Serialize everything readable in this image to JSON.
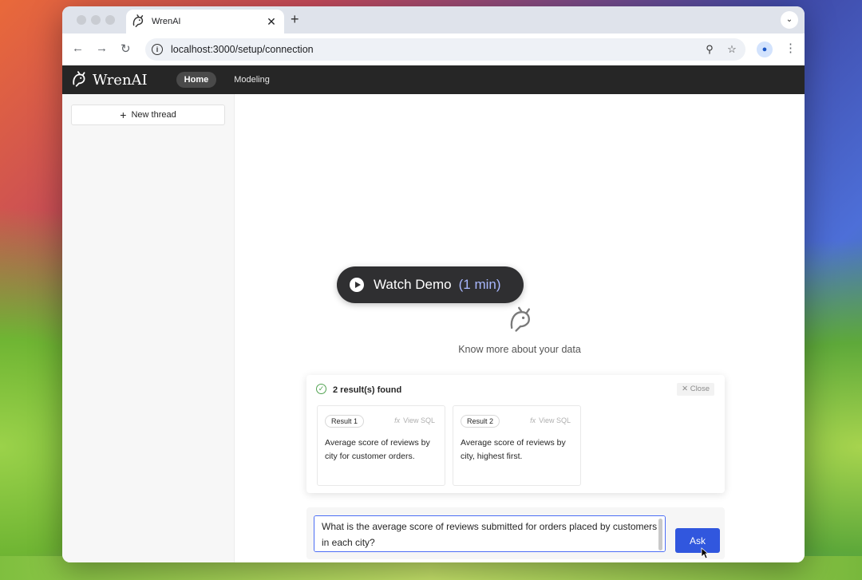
{
  "browser": {
    "tab_title": "WrenAI",
    "tab_close": "✕",
    "new_tab": "+",
    "url": "localhost:3000/setup/connection"
  },
  "app": {
    "brand": "WrenAI",
    "nav": {
      "home": "Home",
      "modeling": "Modeling"
    }
  },
  "sidebar": {
    "new_thread": "New thread"
  },
  "main": {
    "watch_demo": {
      "label": "Watch Demo",
      "duration": "(1 min)"
    },
    "tagline": "Know more about your data",
    "results": {
      "found_text": "2 result(s) found",
      "close_label": "Close",
      "items": [
        {
          "tag": "Result 1",
          "view_sql": "View SQL",
          "text": "Average score of reviews by city for customer orders."
        },
        {
          "tag": "Result 2",
          "view_sql": "View SQL",
          "text": "Average score of reviews by city, highest first."
        }
      ]
    },
    "question": {
      "value": "What is the average score of reviews submitted for orders placed by customers in each city?"
    },
    "ask_label": "Ask"
  },
  "colors": {
    "header_bg": "#262626",
    "primary_button": "#3157de",
    "demo_duration": "#a9b8ff",
    "success": "#52a352"
  }
}
